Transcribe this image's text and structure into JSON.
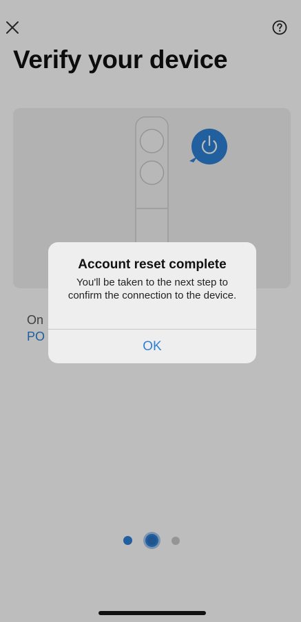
{
  "page": {
    "title": "Verify your device",
    "close_icon": "close-icon",
    "help_icon": "help-icon"
  },
  "instruction": {
    "line1": "On",
    "line2_link": "PO"
  },
  "illustration": {
    "device": "remote-control",
    "badge_icon": "power-icon"
  },
  "pager": {
    "total": 3,
    "current": 2
  },
  "alert": {
    "title": "Account reset complete",
    "message": "You'll be taken to the next step to confirm the connection to the device.",
    "ok_label": "OK"
  },
  "colors": {
    "accent": "#2f80d5",
    "overlay": "rgba(0,0,0,0.26)",
    "alert_bg": "#eeeeee"
  }
}
